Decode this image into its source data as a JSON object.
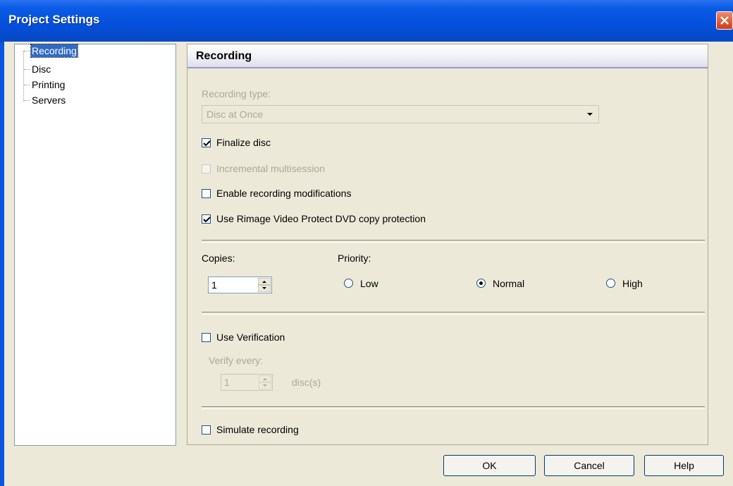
{
  "window": {
    "title": "Project Settings"
  },
  "tree": {
    "items": [
      {
        "label": "Recording",
        "selected": true
      },
      {
        "label": "Disc",
        "selected": false
      },
      {
        "label": "Printing",
        "selected": false
      },
      {
        "label": "Servers",
        "selected": false
      }
    ]
  },
  "panel": {
    "title": "Recording",
    "recording_type_label": "Recording type:",
    "recording_type_value": "Disc at Once",
    "finalize_disc": {
      "label": "Finalize disc",
      "checked": true,
      "enabled": true
    },
    "incremental": {
      "label": "Incremental multisession",
      "checked": false,
      "enabled": false
    },
    "enable_mods": {
      "label": "Enable recording modifications",
      "checked": false,
      "enabled": true
    },
    "video_protect": {
      "label": "Use Rimage Video Protect DVD copy protection",
      "checked": true,
      "enabled": true
    },
    "copies_label": "Copies:",
    "copies_value": "1",
    "priority_label": "Priority:",
    "priority_options": [
      {
        "label": "Low",
        "selected": false
      },
      {
        "label": "Normal",
        "selected": true
      },
      {
        "label": "High",
        "selected": false
      }
    ],
    "use_verification": {
      "label": "Use Verification",
      "checked": false,
      "enabled": true
    },
    "verify_every_label": "Verify every:",
    "verify_every_value": "1",
    "verify_unit": "disc(s)",
    "simulate": {
      "label": "Simulate recording",
      "checked": false,
      "enabled": true
    }
  },
  "buttons": {
    "ok": "OK",
    "cancel": "Cancel",
    "help": "Help"
  },
  "colors": {
    "titlebar": "#0550dc",
    "selection": "#316ac5",
    "dialog_bg": "#ece9d8"
  }
}
